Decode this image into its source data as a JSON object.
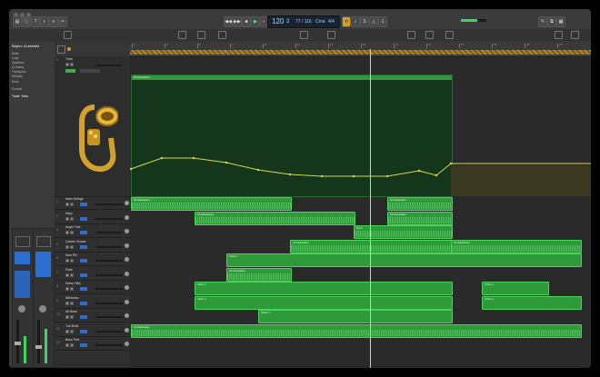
{
  "lcd": {
    "tempo": "120",
    "bar": "3",
    "position": "77 / 116",
    "key": "Cma",
    "signature": "4/4"
  },
  "toolbar": {
    "left": [
      "Edit",
      "Functions",
      "View"
    ],
    "right": [
      "Snap",
      "Smart",
      "Drag",
      "No Overlap"
    ]
  },
  "inspector": {
    "region_title": "Region: 1A selected",
    "rows": [
      "Mute",
      "Loop",
      "Quantize",
      "Q-Swing",
      "Transpose",
      "Velocity"
    ],
    "more": "More",
    "groove": "Groove",
    "track_label": "Track: Tuba"
  },
  "ruler": [
    "1",
    "3",
    "5",
    "7",
    "9",
    "11",
    "13",
    "15",
    "17",
    "19",
    "21",
    "23",
    "25",
    "27"
  ],
  "tracks": [
    {
      "num": "1",
      "name": "Tuba"
    },
    {
      "num": "2",
      "name": "Main Strings"
    },
    {
      "num": "3",
      "name": "Harp"
    },
    {
      "num": "4",
      "name": "Angel Tide"
    },
    {
      "num": "5",
      "name": "Quiche Vivace"
    },
    {
      "num": "6",
      "name": "New Pill"
    },
    {
      "num": "7",
      "name": "Flute"
    },
    {
      "num": "8",
      "name": "Steep Hills"
    },
    {
      "num": "9",
      "name": "Wildness"
    },
    {
      "num": "10",
      "name": "Alt Bass"
    },
    {
      "num": "11",
      "name": "Tuk Bells"
    },
    {
      "num": "12",
      "name": "Bass Part"
    }
  ],
  "region_names": {
    "main": "Orchestration",
    "midi": "Voice 1",
    "short": "Orch"
  },
  "colors": {
    "region": "#2f9a3a",
    "region_border": "#49d35a",
    "automation": "#d8d84a"
  }
}
